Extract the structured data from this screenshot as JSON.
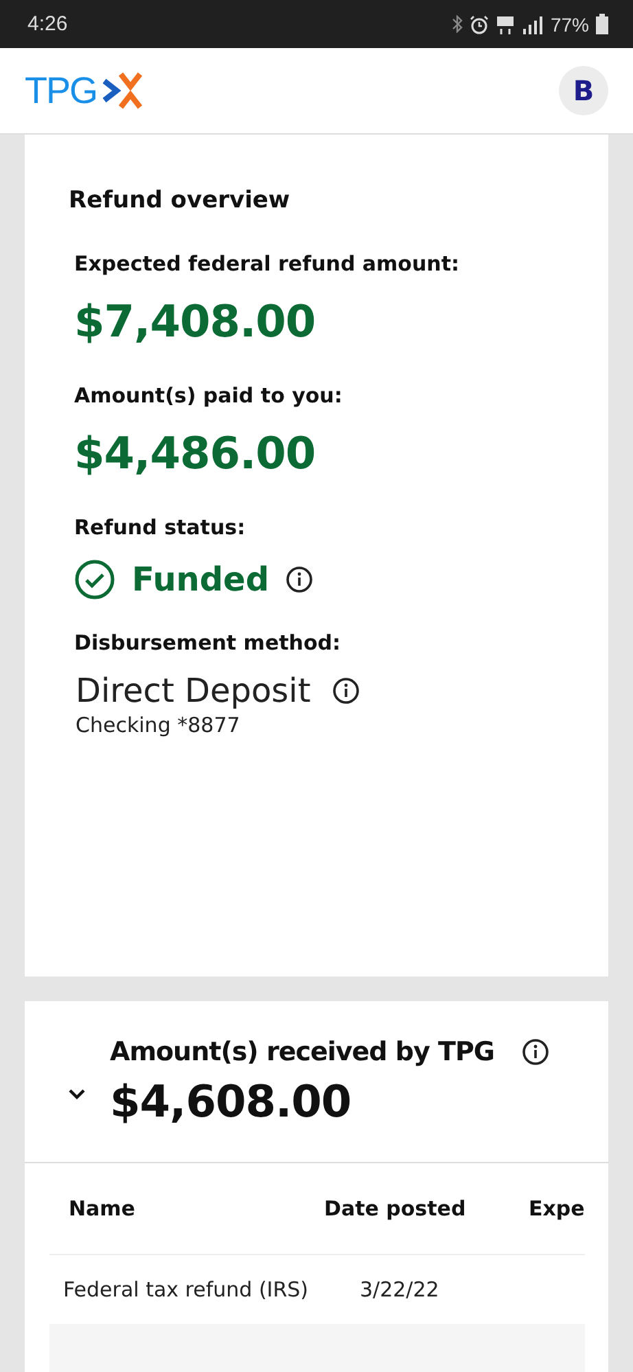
{
  "status_bar": {
    "time": "4:26",
    "battery": "77%"
  },
  "header": {
    "logo": "TPG",
    "avatar": "B"
  },
  "refund_overview": {
    "title": "Refund overview",
    "fields": [
      {
        "kind": "amount",
        "label": "Expected federal refund amount:",
        "value": "$7,408.00"
      },
      {
        "kind": "amount",
        "label": "Amount(s) paid to you:",
        "value": "$4,486.00"
      },
      {
        "kind": "status",
        "label": "Refund status:",
        "value": "Funded"
      },
      {
        "kind": "method",
        "label": "Disbursement method:",
        "value": "Direct Deposit",
        "detail": "Checking *8877"
      }
    ]
  },
  "received": {
    "title": "Amount(s) received by TPG",
    "amount": "$4,608.00",
    "expanded": true,
    "table": {
      "columns": [
        "Name",
        "Date posted",
        "Expe"
      ],
      "rows": [
        {
          "name": "Federal tax refund (IRS)",
          "date_posted": "3/22/22"
        }
      ]
    }
  }
}
